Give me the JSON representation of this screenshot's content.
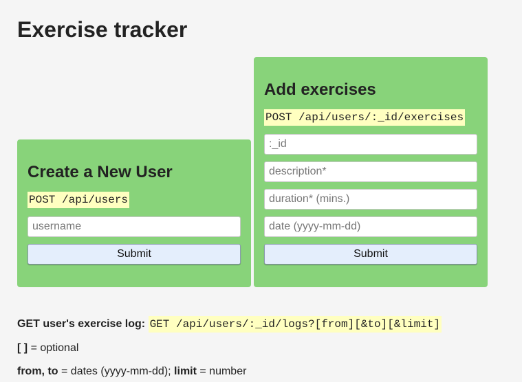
{
  "page": {
    "title": "Exercise tracker"
  },
  "create_user": {
    "heading": "Create a New User",
    "endpoint": "POST /api/users",
    "username_placeholder": "username",
    "submit_label": "Submit"
  },
  "add_exercises": {
    "heading": "Add exercises",
    "endpoint": "POST /api/users/:_id/exercises",
    "id_placeholder": ":_id",
    "description_placeholder": "description*",
    "duration_placeholder": "duration* (mins.)",
    "date_placeholder": "date (yyyy-mm-dd)",
    "submit_label": "Submit"
  },
  "info": {
    "log_label": "GET user's exercise log:",
    "log_endpoint": "GET /api/users/:_id/logs?[from][&to][&limit]",
    "optional_brackets": "[ ]",
    "optional_text": "= optional",
    "from_to_label": "from, to",
    "dates_text": "= dates (yyyy-mm-dd);",
    "limit_label": "limit",
    "number_text": "= number"
  },
  "colors": {
    "card_background": "#88d37a",
    "code_highlight": "#ffffc0",
    "button_background": "#e4eefc",
    "page_background": "#f5f5f5"
  }
}
